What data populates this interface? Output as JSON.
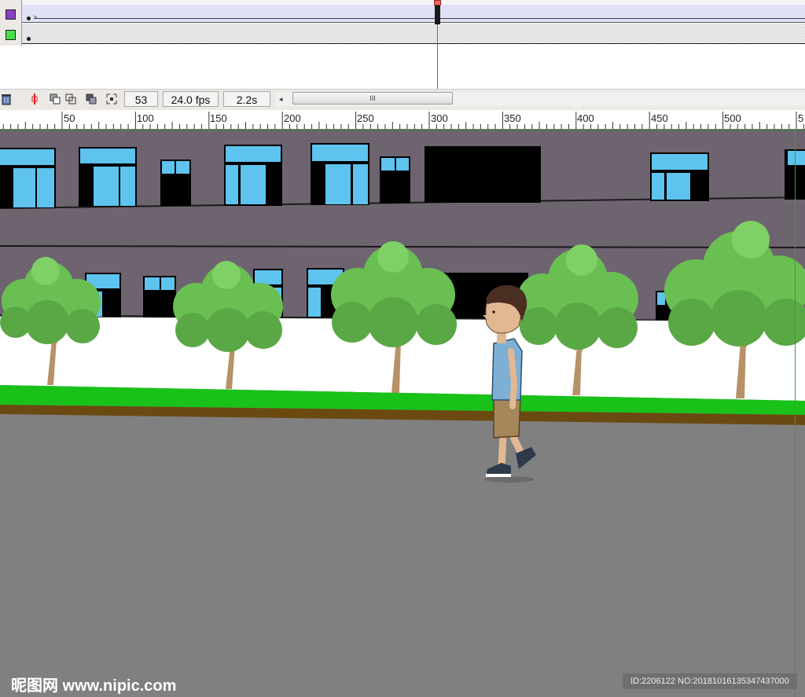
{
  "timeline": {
    "layers": [
      {
        "color": "#8b3fbf"
      },
      {
        "color": "#4ade4a"
      }
    ],
    "playhead_frame": 53
  },
  "toolbar": {
    "trash_icon": "trash-icon",
    "current_frame": "53",
    "frame_rate": "24.0 fps",
    "elapsed_time": "2.2s",
    "scroll_grip": "III",
    "scroll_left_arrow": "◂"
  },
  "ruler": {
    "labels": [
      "50",
      "100",
      "150",
      "200",
      "250",
      "300",
      "350",
      "400",
      "450",
      "500",
      "5"
    ]
  },
  "watermark": {
    "site": "昵图网 www.nipic.com",
    "id_text": "ID:2206122 NO:20181016135347437000"
  },
  "colors": {
    "building": "#6e6470",
    "window_glass": "#5ec3ef",
    "tree_foliage": "#6abf52",
    "grass": "#19c219",
    "road": "#808080",
    "shirt": "#7db0d4",
    "shorts": "#a5875a"
  }
}
